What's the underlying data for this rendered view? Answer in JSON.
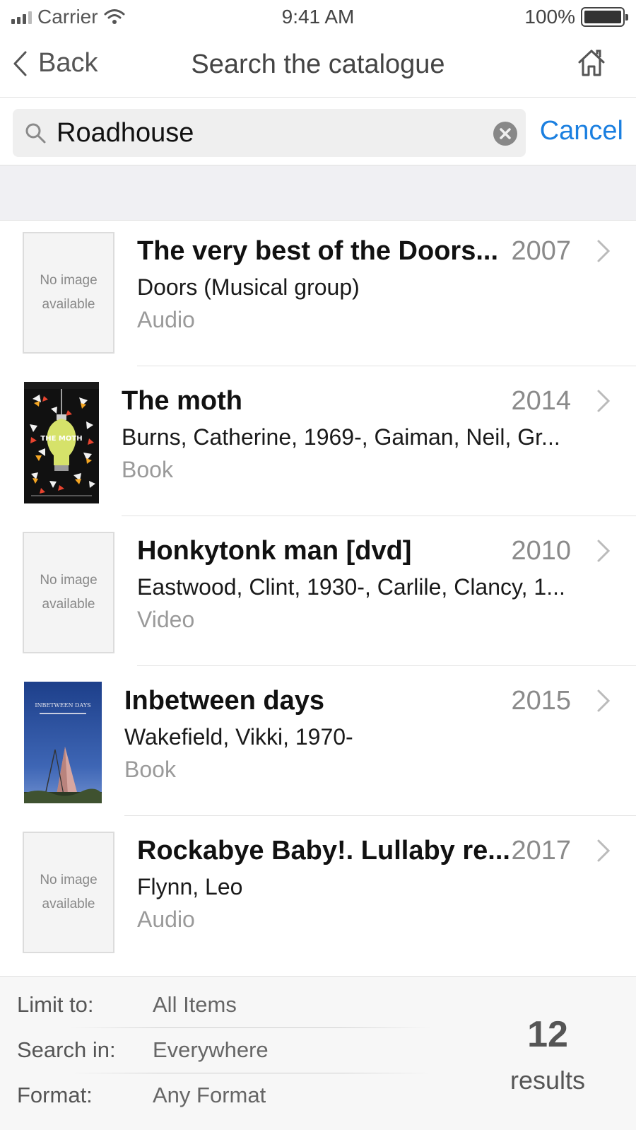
{
  "status_bar": {
    "carrier": "Carrier",
    "time": "9:41 AM",
    "battery": "100%"
  },
  "nav": {
    "back_label": "Back",
    "title": "Search the catalogue"
  },
  "search": {
    "value": "Roadhouse",
    "cancel_label": "Cancel"
  },
  "placeholder_image_text": {
    "line1": "No image",
    "line2": "available"
  },
  "results": [
    {
      "title": "The very best of the Doors...",
      "year": "2007",
      "author": "Doors (Musical group)",
      "format": "Audio",
      "cover": "none"
    },
    {
      "title": "The moth",
      "year": "2014",
      "author": "Burns, Catherine, 1969-, Gaiman, Neil, Gr...",
      "format": "Book",
      "cover": "the-moth-cover",
      "cover_text": "THE MOTH"
    },
    {
      "title": "Honkytonk man [dvd]",
      "year": "2010",
      "author": "Eastwood, Clint, 1930-, Carlile, Clancy, 1...",
      "format": "Video",
      "cover": "none"
    },
    {
      "title": "Inbetween days",
      "year": "2015",
      "author": "Wakefield, Vikki, 1970-",
      "format": "Book",
      "cover": "inbetween-days-cover",
      "cover_text": "INBETWEEN DAYS"
    },
    {
      "title": "Rockabye Baby!. Lullaby re...",
      "year": "2017",
      "author": "Flynn, Leo",
      "format": "Audio",
      "cover": "none"
    }
  ],
  "filters": {
    "limit_label": "Limit to:",
    "limit_value": "All Items",
    "search_in_label": "Search in:",
    "search_in_value": "Everywhere",
    "format_label": "Format:",
    "format_value": "Any Format"
  },
  "results_count": {
    "count": "12",
    "label": "results"
  },
  "colors": {
    "accent": "#1a7fe0"
  }
}
